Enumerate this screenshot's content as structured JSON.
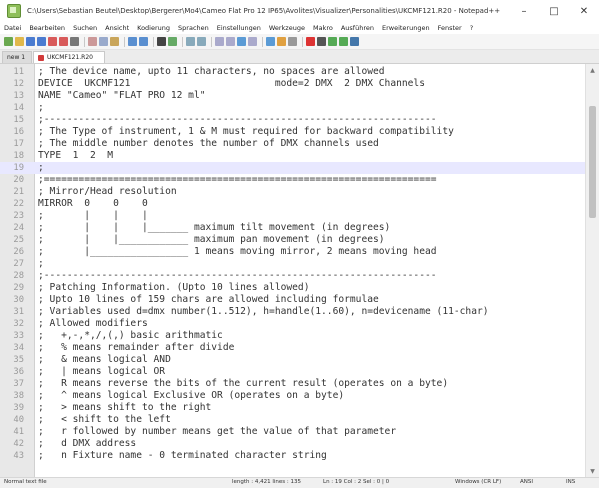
{
  "window": {
    "title": "C:\\Users\\Sebastian Beutel\\Desktop\\Bergerer\\Mo4\\Cameo Flat Pro 12 IP65\\Avolites\\Visualizer\\Personalities\\UKCMF121.R20 - Notepad++",
    "minimize": "–",
    "maximize": "□",
    "close": "✕"
  },
  "menu": [
    "Datei",
    "Bearbeiten",
    "Suchen",
    "Ansicht",
    "Kodierung",
    "Sprachen",
    "Einstellungen",
    "Werkzeuge",
    "Makro",
    "Ausführen",
    "Erweiterungen",
    "Fenster",
    "?"
  ],
  "tabs": [
    {
      "label": "new 1"
    },
    {
      "label": "UKCMF121.R20"
    }
  ],
  "editor": {
    "lines": [
      {
        "n": "11",
        "text": "; The device name, upto 11 characters, no spaces are allowed"
      },
      {
        "n": "12",
        "text": "DEVICE  UKCMF121                         mode=2 DMX  2 DMX Channels"
      },
      {
        "n": "13",
        "text": "NAME \"Cameo\" \"FLAT PRO 12 ml\""
      },
      {
        "n": "14",
        "text": ";"
      },
      {
        "n": "15",
        "text": ";--------------------------------------------------------------------"
      },
      {
        "n": "16",
        "text": "; The Type of instrument, 1 & M must required for backward compatibility"
      },
      {
        "n": "17",
        "text": "; The middle number denotes the number of DMX channels used"
      },
      {
        "n": "18",
        "text": "TYPE  1  2  M"
      },
      {
        "n": "19",
        "text": ";"
      },
      {
        "n": "20",
        "text": ";===================================================================="
      },
      {
        "n": "21",
        "text": "; Mirror/Head resolution"
      },
      {
        "n": "22",
        "text": "MIRROR  0    0    0"
      },
      {
        "n": "23",
        "text": ";       |    |    |"
      },
      {
        "n": "24",
        "text": ";       |    |    |_______ maximum tilt movement (in degrees)"
      },
      {
        "n": "25",
        "text": ";       |    |____________ maximum pan movement (in degrees)"
      },
      {
        "n": "26",
        "text": ";       |_________________ 1 means moving mirror, 2 means moving head"
      },
      {
        "n": "27",
        "text": ";"
      },
      {
        "n": "28",
        "text": ";--------------------------------------------------------------------"
      },
      {
        "n": "29",
        "text": "; Patching Information. (Upto 10 lines allowed)"
      },
      {
        "n": "30",
        "text": "; Upto 10 lines of 159 chars are allowed including formulae"
      },
      {
        "n": "31",
        "text": "; Variables used d=dmx number(1..512), h=handle(1..60), n=devicename (11-char)"
      },
      {
        "n": "32",
        "text": "; Allowed modifiers"
      },
      {
        "n": "33",
        "text": ";   +,-,*,/,(,) basic arithmatic"
      },
      {
        "n": "34",
        "text": ";   % means remainder after divide"
      },
      {
        "n": "35",
        "text": ";   & means logical AND"
      },
      {
        "n": "36",
        "text": ";   | means logical OR"
      },
      {
        "n": "37",
        "text": ";   R means reverse the bits of the current result (operates on a byte)"
      },
      {
        "n": "38",
        "text": ";   ^ means logical Exclusive OR (operates on a byte)"
      },
      {
        "n": "39",
        "text": ";   > means shift to the right"
      },
      {
        "n": "40",
        "text": ";   < shift to the left"
      },
      {
        "n": "41",
        "text": ";   r followed by number means get the value of that parameter"
      },
      {
        "n": "42",
        "text": ";   d DMX address"
      },
      {
        "n": "43",
        "text": ";   n Fixture name - 0 terminated character string"
      }
    ],
    "current_line": "19"
  },
  "status": {
    "file_type": "Normal text file",
    "length": "length : 4,421    lines : 135",
    "position": "Ln : 19    Col : 2    Sel : 0 | 0",
    "eol": "Windows (CR LF)",
    "encoding": "ANSI",
    "mode": "INS"
  },
  "colors": {
    "gutter": "#e8e8e8",
    "current_line": "#e8e8ff",
    "tab_marker": "#d23b3b"
  }
}
